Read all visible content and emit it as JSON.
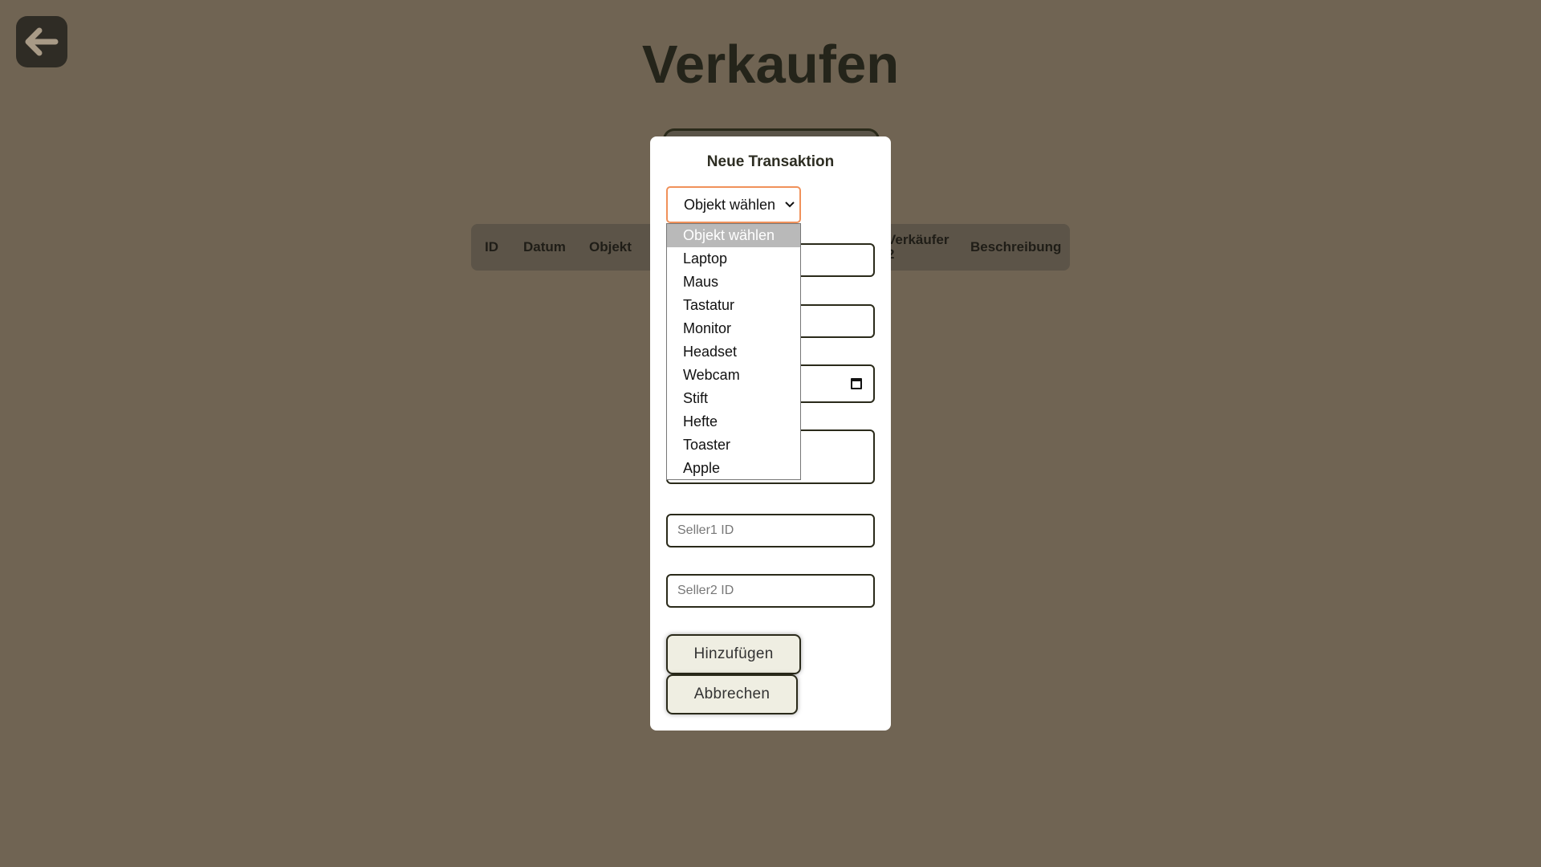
{
  "page": {
    "title": "Verkaufen",
    "background": "#706453"
  },
  "back_button": {
    "icon": "arrow-left-icon"
  },
  "table": {
    "headers": [
      "ID",
      "Datum",
      "Objekt",
      "Verkäufer 2",
      "Beschreibung"
    ]
  },
  "modal": {
    "title": "Neue Transaktion",
    "object_select": {
      "value": "Objekt wählen",
      "options": [
        "Objekt wählen",
        "Laptop",
        "Maus",
        "Tastatur",
        "Monitor",
        "Headset",
        "Webcam",
        "Stift",
        "Hefte",
        "Toaster",
        "Apple"
      ],
      "highlighted": "Objekt wählen",
      "accent": "#f0915a"
    },
    "seller1": {
      "placeholder": "Seller1 ID"
    },
    "seller2": {
      "placeholder": "Seller2 ID"
    },
    "add_button": "Hinzufügen",
    "cancel_button": "Abbrechen"
  }
}
